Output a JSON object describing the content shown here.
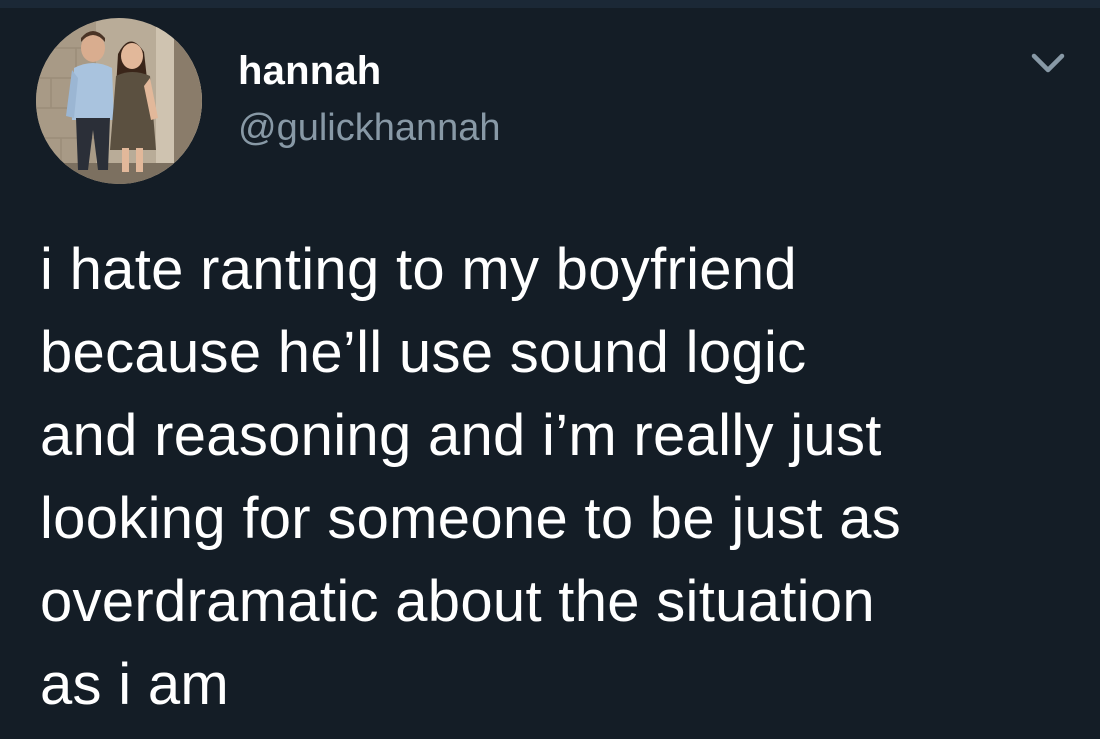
{
  "tweet": {
    "author": {
      "display_name": "hannah",
      "handle": "@gulickhannah",
      "avatar_icon": "profile-photo-avatar"
    },
    "menu_icon": "chevron-down-icon",
    "text_lines": [
      "i hate ranting to my boyfriend",
      "because he’ll use sound logic",
      "and reasoning and i’m really just",
      "looking for someone to be just as",
      "overdramatic about the situation",
      "as i am"
    ]
  },
  "colors": {
    "background": "#141d26",
    "text_primary": "#ffffff",
    "text_secondary": "#8899a6"
  }
}
